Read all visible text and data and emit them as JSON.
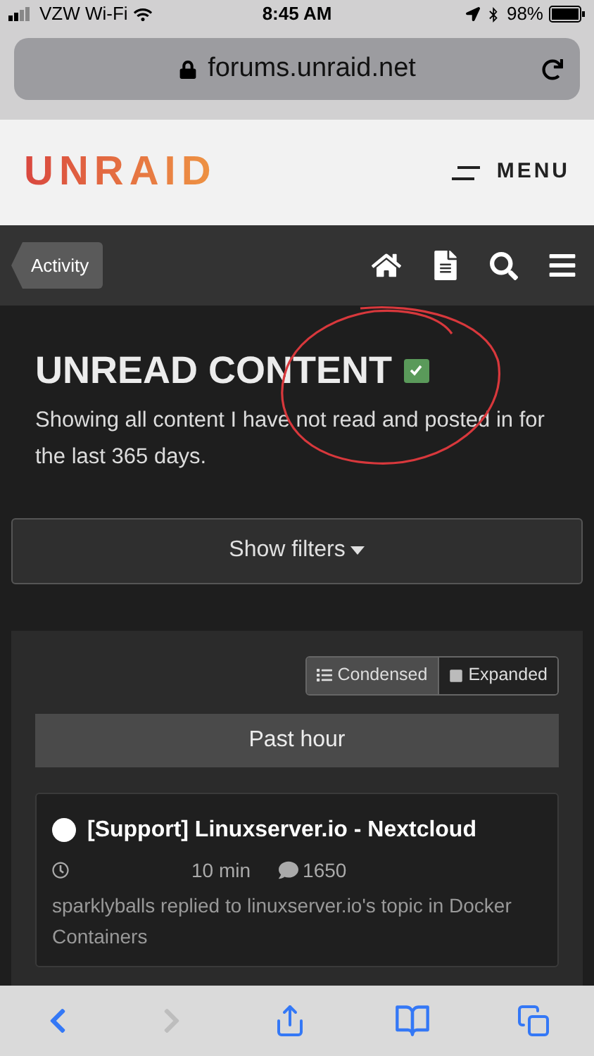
{
  "status_bar": {
    "carrier": "VZW Wi-Fi",
    "time": "8:45 AM",
    "battery": "98%"
  },
  "address_bar": {
    "url": "forums.unraid.net"
  },
  "site_header": {
    "logo": "UNRAID",
    "menu": "MENU"
  },
  "nav": {
    "breadcrumb": "Activity"
  },
  "page": {
    "title": "UNREAD CONTENT",
    "checked": true,
    "description": "Showing all content I have not read and posted in for the last 365 days.",
    "filters": "Show filters"
  },
  "view_toggle": [
    {
      "label": "Condensed",
      "selected": true
    },
    {
      "label": "Expanded",
      "selected": false
    }
  ],
  "section": "Past hour",
  "topics": [
    {
      "title": "[Support] Linuxserver.io - Nextcloud",
      "unread": true,
      "time": "10 min",
      "replies": "1650",
      "summary": "sparklyballs replied to linuxserver.io's topic in Docker Containers"
    }
  ],
  "toolbar": {
    "back_disabled": false,
    "forward_disabled": true
  }
}
